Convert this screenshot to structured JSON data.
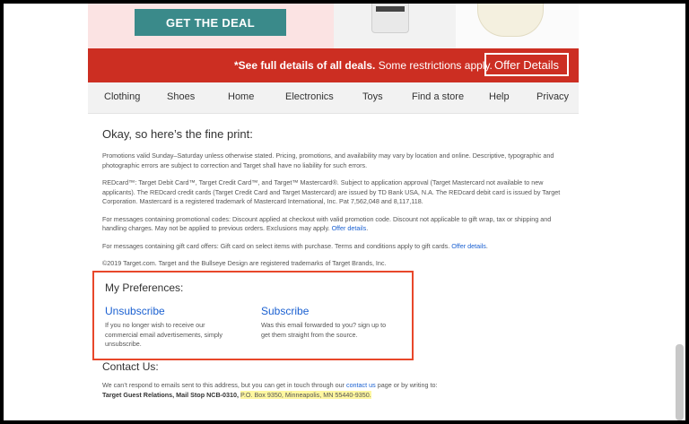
{
  "hero": {
    "deal_button": "GET THE DEAL"
  },
  "banner": {
    "bold_text": "*See full details of all deals.",
    "text": "Some restrictions apply.",
    "offer_button": "Offer Details"
  },
  "nav": {
    "items": [
      {
        "label": "Clothing"
      },
      {
        "label": "Shoes"
      },
      {
        "label": "Home"
      },
      {
        "label": "Electronics"
      },
      {
        "label": "Toys"
      },
      {
        "label": "Find a store"
      },
      {
        "label": "Help"
      },
      {
        "label": "Privacy"
      }
    ]
  },
  "fine_print": {
    "title": "Okay, so here’s the fine print:",
    "p1": "Promotions valid Sunday–Saturday unless otherwise stated. Pricing, promotions, and availability may vary by location and online. Descriptive, typographic and photographic errors are subject to correction and Target shall have no liability for such errors.",
    "p2": "REDcard™: Target Debit Card™, Target Credit Card™, and Target™ Mastercard®. Subject to application approval (Target Mastercard not available to new applicants). The REDcard credit cards (Target Credit Card and Target Mastercard) are issued by TD Bank USA, N.A. The REDcard debit card is issued by Target Corporation. Mastercard is a registered trademark of Mastercard International, Inc. Pat 7,562,048 and 8,117,118.",
    "p3": "For messages containing promotional codes: Discount applied at checkout with valid promotion code. Discount not applicable to gift wrap, tax or shipping and handling charges. May not be applied to previous orders. Exclusions may apply.",
    "p3_link": "Offer details",
    "p4": "For messages containing gift card offers: Gift card on select items with purchase. Terms and conditions apply to gift cards.",
    "p4_link": "Offer details",
    "p5": "©2019 Target.com. Target and the Bullseye Design are registered trademarks of Target Brands, Inc."
  },
  "preferences": {
    "title": "My Preferences:",
    "unsubscribe": {
      "label": "Unsubscribe",
      "desc": "If you no longer wish to receive our commercial email advertisements, simply unsubscribe."
    },
    "subscribe": {
      "label": "Subscribe",
      "desc": "Was this email forwarded to you? sign up to get them straight from the source."
    }
  },
  "contact": {
    "title": "Contact Us:",
    "line1_pre": "We can’t respond to emails sent to this address, but you can get in touch through our",
    "line1_link": "contact us",
    "line1_post": "page or by writing to:",
    "address_bold": "Target Guest Relations, Mail Stop NCB-0310,",
    "address_highlight": "P.O. Box 9350, Minneapolis, MN 55440-9350."
  },
  "colors": {
    "red_banner": "#cc2e22",
    "deal_button": "#3a8a8a",
    "link": "#1a60d1",
    "highlight_box": "#e8472a"
  }
}
